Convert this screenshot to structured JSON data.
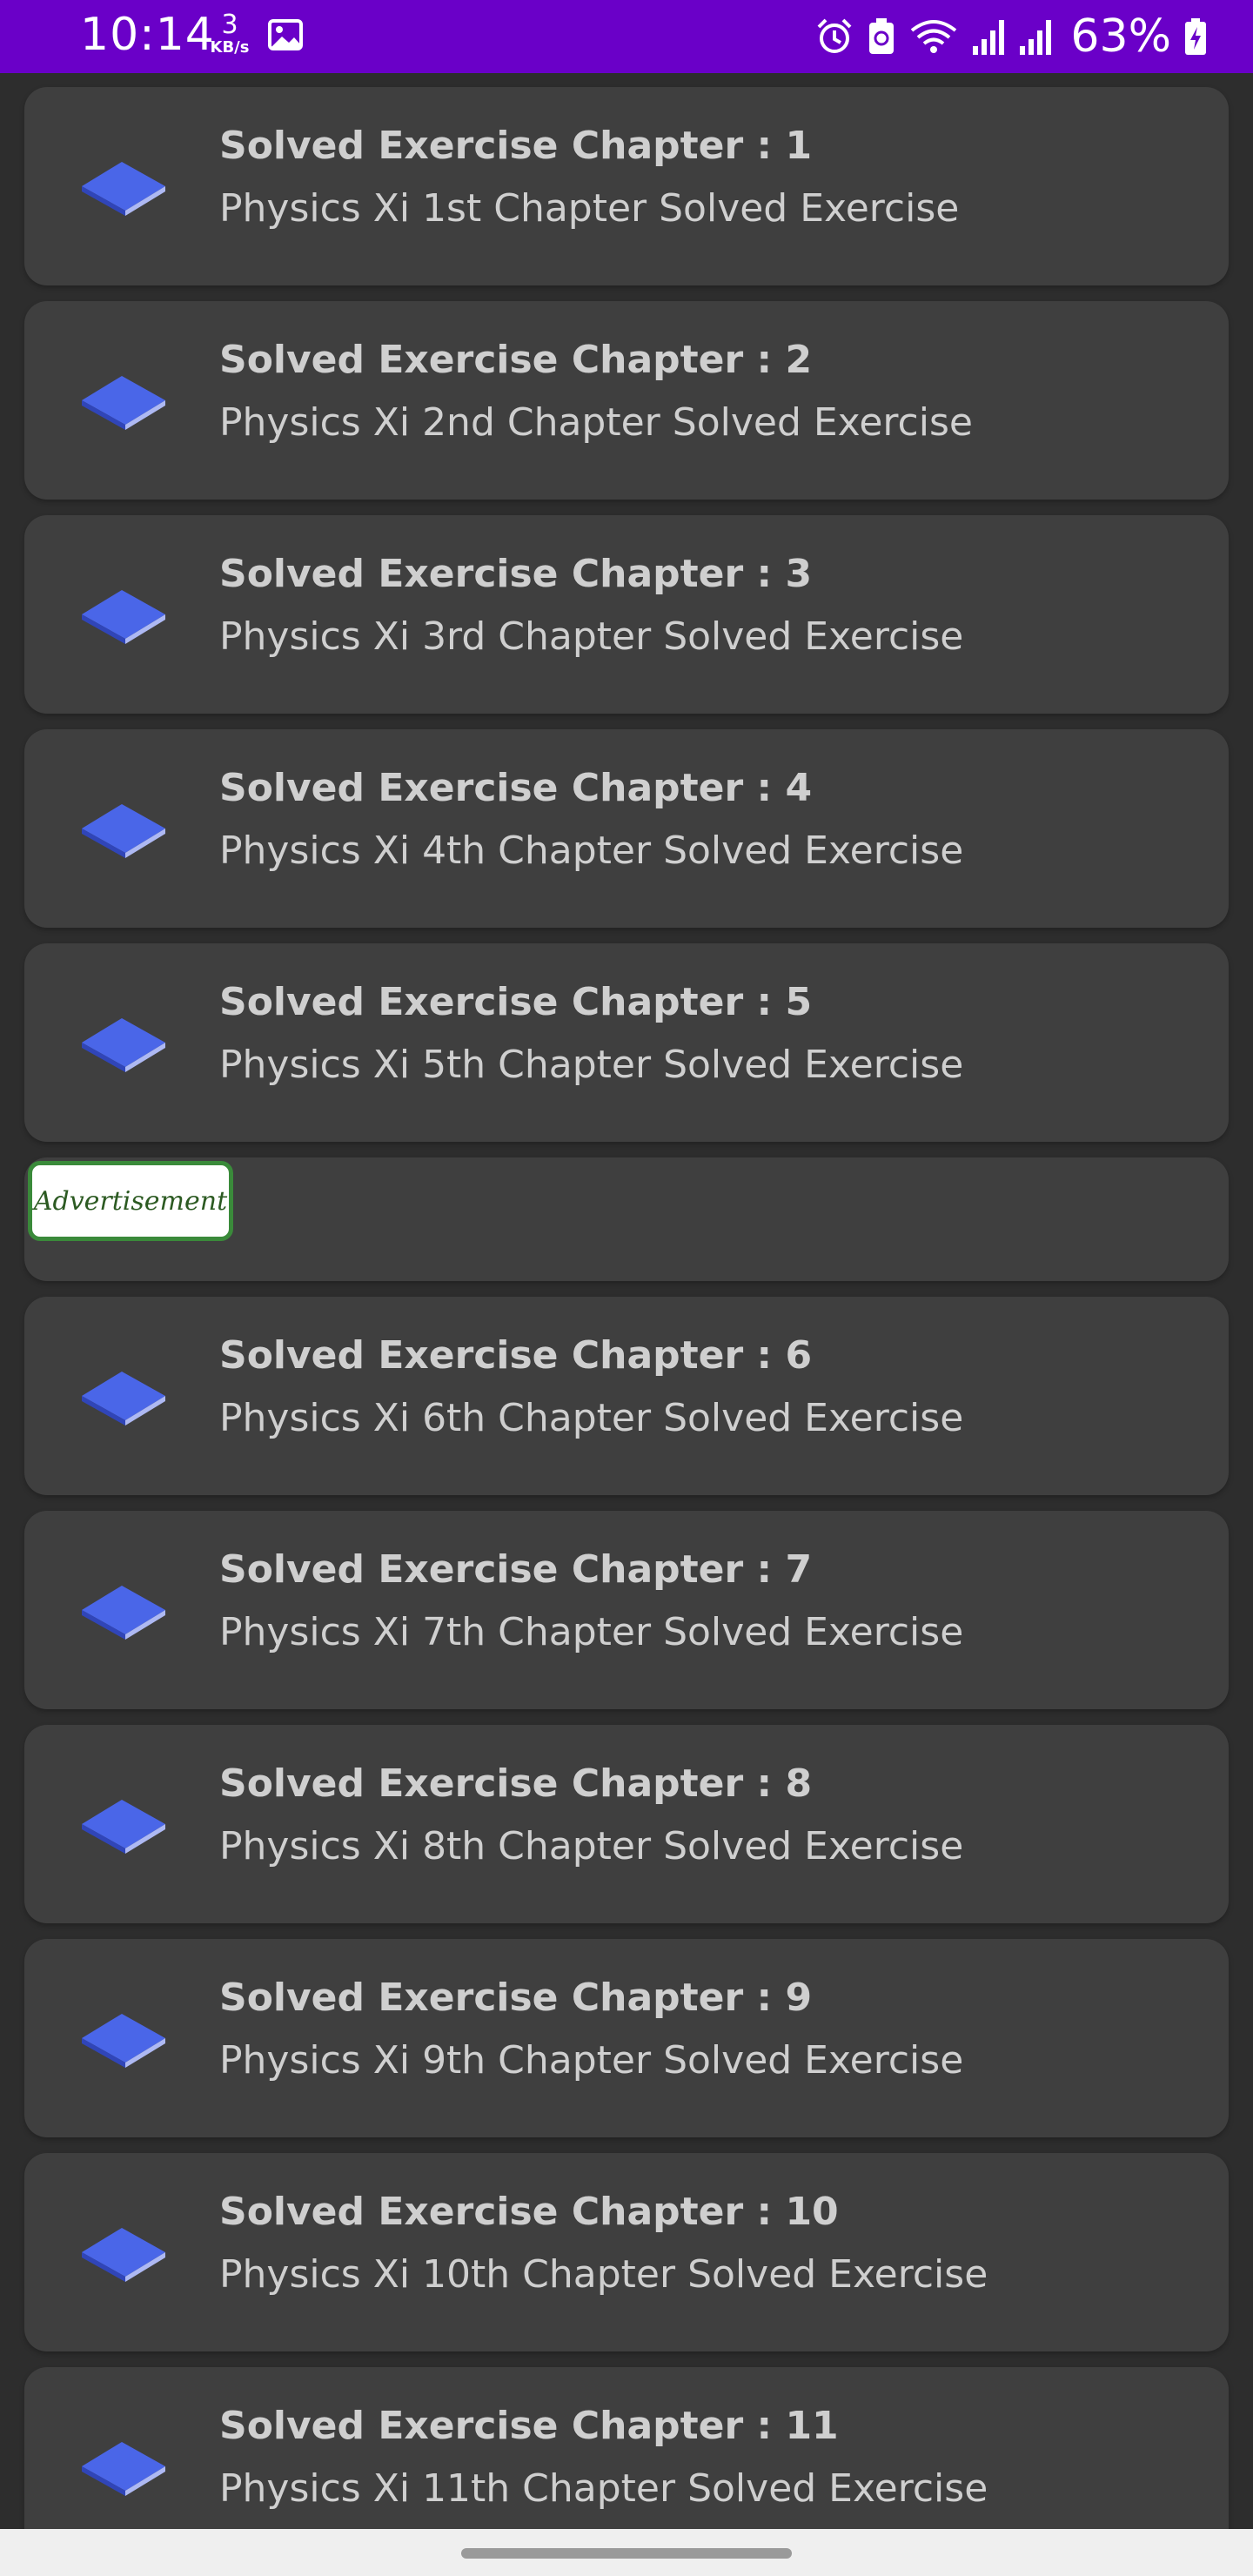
{
  "status_bar": {
    "time": "10:14",
    "net_speed_value": "3",
    "net_speed_unit": "KB/s",
    "battery_percent": "63%",
    "icons": [
      "image-icon",
      "alarm-icon",
      "battery-saver-icon",
      "wifi-icon",
      "signal-icon",
      "signal-icon",
      "battery-charging-icon"
    ]
  },
  "colors": {
    "status_bar": "#6a00c8",
    "background": "#2d2d2d",
    "card": "#3f3f3f",
    "text": "#cfcfcf",
    "icon_blue": "#4a66e8",
    "ad_border": "#3a8a3a"
  },
  "items": [
    {
      "title": "Solved Exercise Chapter : 1",
      "subtitle": "Physics Xi 1st Chapter Solved Exercise",
      "icon": "book-icon"
    },
    {
      "title": "Solved Exercise Chapter : 2",
      "subtitle": "Physics Xi 2nd Chapter Solved Exercise",
      "icon": "book-icon"
    },
    {
      "title": "Solved Exercise Chapter : 3",
      "subtitle": "Physics Xi 3rd Chapter Solved Exercise",
      "icon": "book-icon"
    },
    {
      "title": "Solved Exercise Chapter : 4",
      "subtitle": "Physics Xi 4th Chapter Solved Exercise",
      "icon": "book-icon"
    },
    {
      "title": "Solved Exercise Chapter : 5",
      "subtitle": "Physics Xi 5th Chapter Solved Exercise",
      "icon": "book-icon"
    },
    {
      "title": "Solved Exercise Chapter : 6",
      "subtitle": "Physics Xi 6th Chapter Solved Exercise",
      "icon": "book-icon"
    },
    {
      "title": "Solved Exercise Chapter : 7",
      "subtitle": "Physics Xi 7th Chapter Solved Exercise",
      "icon": "book-icon"
    },
    {
      "title": "Solved Exercise Chapter : 8",
      "subtitle": "Physics Xi 8th Chapter Solved Exercise",
      "icon": "book-icon"
    },
    {
      "title": "Solved Exercise Chapter : 9",
      "subtitle": "Physics Xi 9th Chapter Solved Exercise",
      "icon": "book-icon"
    },
    {
      "title": "Solved Exercise Chapter : 10",
      "subtitle": "Physics Xi 10th Chapter Solved Exercise",
      "icon": "book-icon"
    },
    {
      "title": "Solved Exercise Chapter : 11",
      "subtitle": "Physics Xi 11th Chapter Solved Exercise",
      "icon": "book-icon"
    }
  ],
  "ad": {
    "label": "Advertisement"
  }
}
